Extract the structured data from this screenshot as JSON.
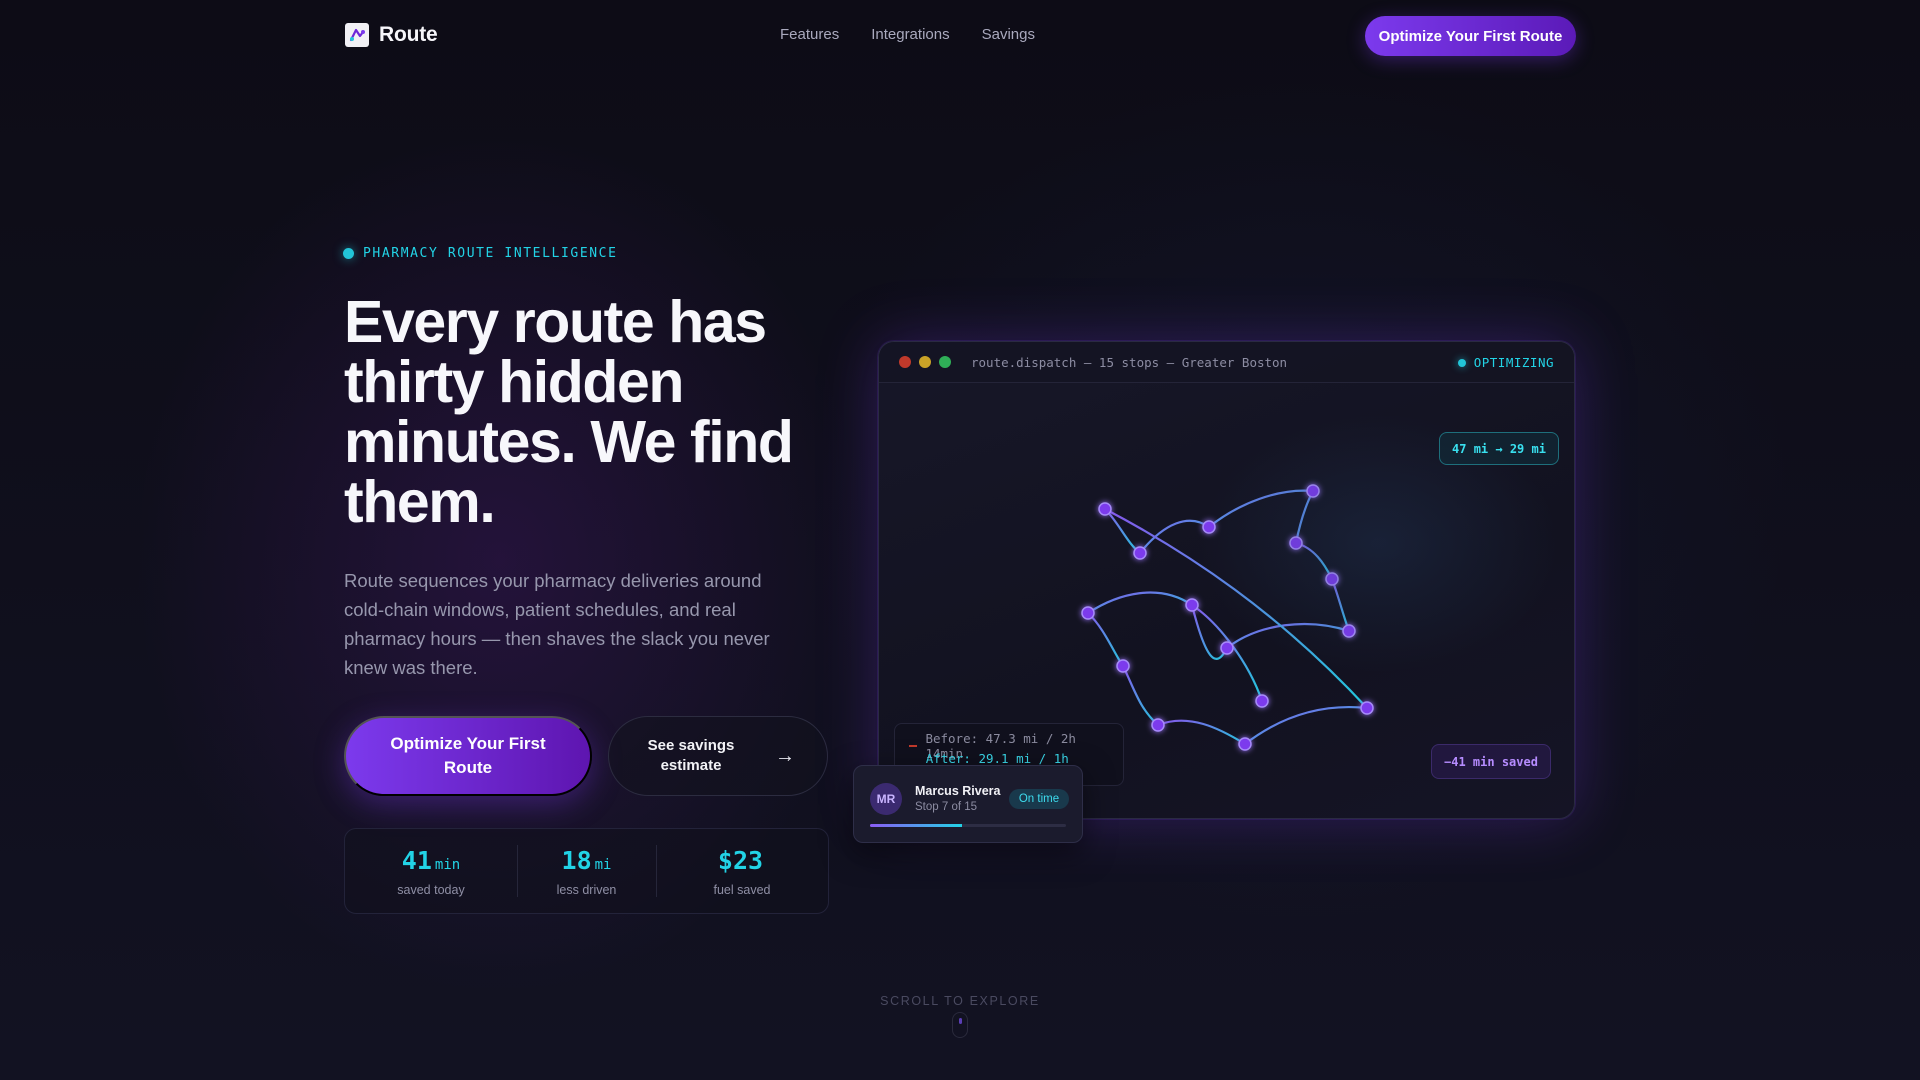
{
  "brand": {
    "name": "Route",
    "logo_icon": "route-logo-icon"
  },
  "nav": {
    "links": [
      "Features",
      "Integrations",
      "Savings"
    ],
    "cta_label": "Optimize Your First Route"
  },
  "hero": {
    "eyebrow": "PHARMACY ROUTE INTELLIGENCE",
    "headline": "Every route has thirty hidden minutes. We find them.",
    "subcopy": "Route sequences your pharmacy deliveries around cold-chain windows, patient schedules, and real pharmacy hours — then shaves the slack you never knew was there.",
    "primary_cta": "Optimize Your First Route",
    "secondary_cta": "See savings estimate",
    "secondary_cta_icon": "arrow-right-icon",
    "secondary_cta_arrow": "→"
  },
  "stats": [
    {
      "value": "41",
      "unit": "min",
      "label": "saved today"
    },
    {
      "value": "18",
      "unit": "mi",
      "label": "less driven"
    },
    {
      "value": "$23",
      "unit": "",
      "label": "fuel saved"
    }
  ],
  "scroll_hint": "SCROLL TO EXPLORE",
  "dashboard": {
    "title": "route.dispatch — 15 stops — Greater Boston",
    "status": "OPTIMIZING",
    "distance_pill": "47 mi → 29 mi",
    "legend": {
      "before": "Before: 47.3 mi / 2h 14min",
      "after": "After: 29.1 mi / 1h 33min"
    },
    "saved_pill": "−41 min saved",
    "colors": {
      "before_route": "#c0392b",
      "after_route": "#22d3e6",
      "stop": "#7c3aed"
    }
  },
  "driver": {
    "initials": "MR",
    "name": "Marcus Rivera",
    "stop": "Stop 7 of 15",
    "status": "On time",
    "progress": 0.47
  },
  "accent_colors": {
    "purple": "#7c3aed",
    "cyan": "#22d3e6",
    "background": "#0f0e1a"
  }
}
